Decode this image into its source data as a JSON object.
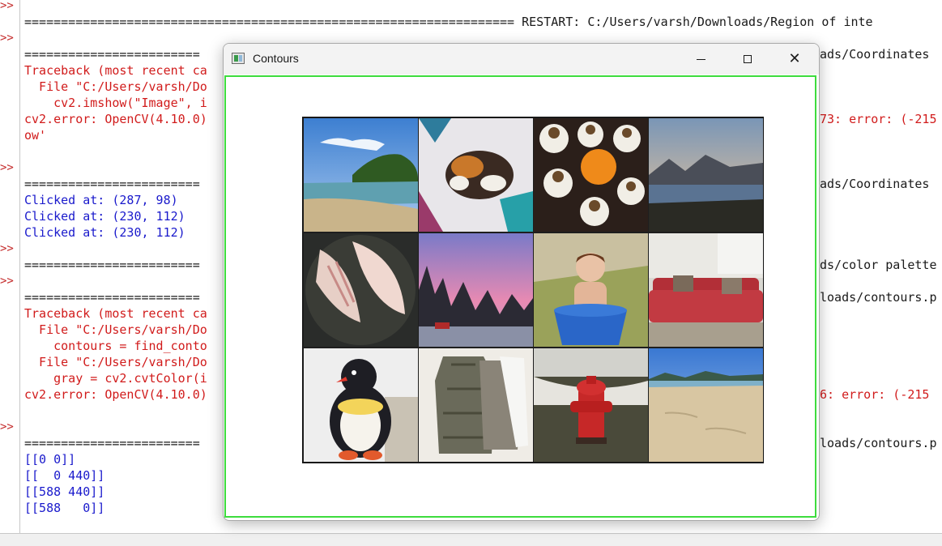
{
  "shell": {
    "prompt": ">>",
    "lines": [
      {
        "text": "=================================================================== RESTART: C:/Users/varsh/Downloads/Region of inte",
        "color": "black"
      },
      {
        "text": "========================",
        "color": "black"
      },
      {
        "text": "Traceback (most recent ca",
        "color": "red"
      },
      {
        "text": "  File \"C:/Users/varsh/Do",
        "color": "red"
      },
      {
        "text": "    cv2.imshow(\"Image\", i",
        "color": "red"
      },
      {
        "text": "cv2.error: OpenCV(4.10.0)",
        "color": "red"
      },
      {
        "text": "ow'",
        "color": "red"
      },
      {
        "text": "========================",
        "color": "black"
      },
      {
        "text": "Clicked at: (287, 98)",
        "color": "blue"
      },
      {
        "text": "Clicked at: (230, 112)",
        "color": "blue"
      },
      {
        "text": "Clicked at: (230, 112)",
        "color": "blue"
      },
      {
        "text": "========================",
        "color": "black"
      },
      {
        "text": "========================",
        "color": "black"
      },
      {
        "text": "Traceback (most recent ca",
        "color": "red"
      },
      {
        "text": "  File \"C:/Users/varsh/Do",
        "color": "red"
      },
      {
        "text": "    contours = find_conto",
        "color": "red"
      },
      {
        "text": "  File \"C:/Users/varsh/Do",
        "color": "red"
      },
      {
        "text": "    gray = cv2.cvtColor(i",
        "color": "red"
      },
      {
        "text": "cv2.error: OpenCV(4.10.0)",
        "color": "red"
      },
      {
        "text": "========================",
        "color": "black"
      },
      {
        "text": "[[0 0]]",
        "color": "blue"
      },
      {
        "text": "[[  0 440]]",
        "color": "blue"
      },
      {
        "text": "[[588 440]]",
        "color": "blue"
      },
      {
        "text": "[[588   0]]",
        "color": "blue"
      }
    ],
    "right_fragments": [
      {
        "text": "ads/Coordinates",
        "color": "black"
      },
      {
        "text": "73: error: (-215",
        "color": "red"
      },
      {
        "text": "ads/Coordinates",
        "color": "black"
      },
      {
        "text": "ds/color palette",
        "color": "black"
      },
      {
        "text": "loads/contours.p",
        "color": "black"
      },
      {
        "text": "6: error: (-215",
        "color": "red"
      },
      {
        "text": "loads/contours.p",
        "color": "black"
      }
    ]
  },
  "window": {
    "title": "Contours",
    "minimize_label": "—",
    "maximize_label": "☐",
    "close_label": "✕"
  },
  "image_grid": {
    "tiles": [
      {
        "name": "tile-beach-cove",
        "desc": "beach with tree-covered headland"
      },
      {
        "name": "tile-calico-cat",
        "desc": "calico cat sleeping on quilt"
      },
      {
        "name": "tile-cupcakes",
        "desc": "chocolate cupcakes with frosting"
      },
      {
        "name": "tile-lake-mountains",
        "desc": "lake with mountains at dusk"
      },
      {
        "name": "tile-fish-fillet",
        "desc": "raw fish fillets in pan"
      },
      {
        "name": "tile-pink-sky",
        "desc": "snowy trees under pink sky"
      },
      {
        "name": "tile-child-tub",
        "desc": "child sitting in blue tub"
      },
      {
        "name": "tile-red-sofa",
        "desc": "red sofa in room"
      },
      {
        "name": "tile-penguin-toy",
        "desc": "stuffed penguin toy"
      },
      {
        "name": "tile-shirts",
        "desc": "shirts hanging on door"
      },
      {
        "name": "tile-fire-hydrant",
        "desc": "red fire hydrant on grass"
      },
      {
        "name": "tile-sandy-beach",
        "desc": "sandy beach with hills"
      }
    ]
  },
  "colors": {
    "accent_border": "#3ddc3d",
    "traceback_red": "#d11b1b",
    "output_blue": "#1a1acc"
  }
}
